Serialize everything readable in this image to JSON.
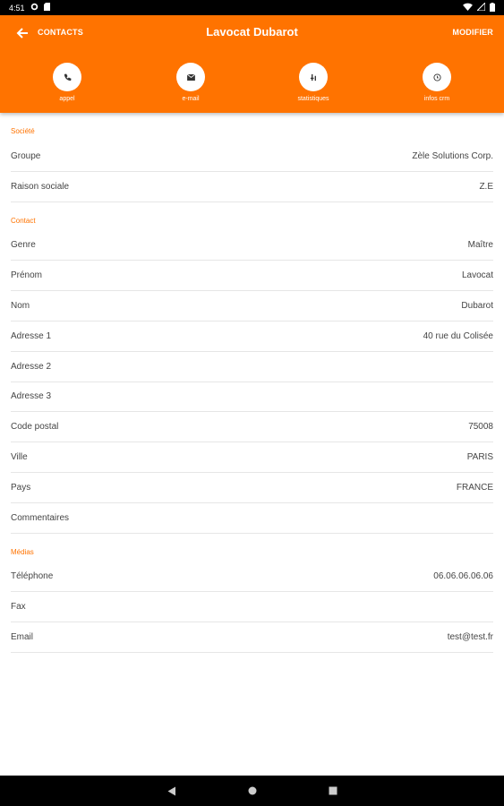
{
  "status": {
    "time": "4:51"
  },
  "appbar": {
    "back_label": "CONTACTS",
    "title": "Lavocat Dubarot",
    "edit_label": "MODIFIER",
    "actions": [
      {
        "label": "appel",
        "icon": "phone-icon"
      },
      {
        "label": "e-mail",
        "icon": "mail-icon"
      },
      {
        "label": "statistiques",
        "icon": "stats-icon"
      },
      {
        "label": "infos crm",
        "icon": "info-icon"
      }
    ]
  },
  "sections": [
    {
      "title": "Société",
      "rows": [
        {
          "label": "Groupe",
          "value": "Zèle Solutions Corp."
        },
        {
          "label": "Raison sociale",
          "value": "Z.E"
        }
      ]
    },
    {
      "title": "Contact",
      "rows": [
        {
          "label": "Genre",
          "value": "Maître"
        },
        {
          "label": "Prénom",
          "value": "Lavocat"
        },
        {
          "label": "Nom",
          "value": "Dubarot"
        },
        {
          "label": "Adresse 1",
          "value": "40 rue du Colisée"
        },
        {
          "label": "Adresse 2",
          "value": ""
        },
        {
          "label": "Adresse 3",
          "value": ""
        },
        {
          "label": "Code postal",
          "value": "75008"
        },
        {
          "label": "Ville",
          "value": "PARIS"
        },
        {
          "label": "Pays",
          "value": "FRANCE"
        },
        {
          "label": "Commentaires",
          "value": ""
        }
      ]
    },
    {
      "title": "Médias",
      "rows": [
        {
          "label": "Téléphone",
          "value": "06.06.06.06.06"
        },
        {
          "label": "Fax",
          "value": ""
        },
        {
          "label": "Email",
          "value": "test@test.fr"
        }
      ]
    }
  ],
  "colors": {
    "accent": "#ff7300"
  }
}
